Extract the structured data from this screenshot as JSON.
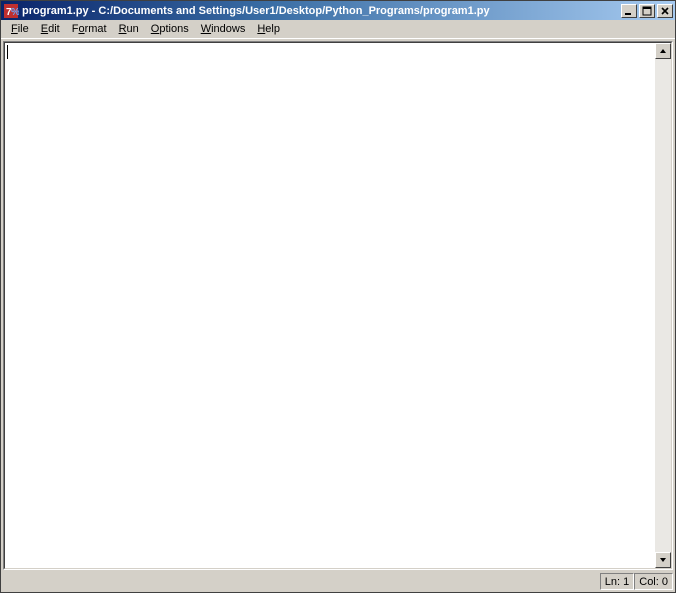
{
  "titlebar": {
    "title": "program1.py - C:/Documents and Settings/User1/Desktop/Python_Programs/program1.py"
  },
  "menu": {
    "file": "File",
    "edit": "Edit",
    "format": "Format",
    "run": "Run",
    "options": "Options",
    "windows": "Windows",
    "help": "Help"
  },
  "editor": {
    "content": ""
  },
  "status": {
    "line": "Ln: 1",
    "col": "Col: 0"
  }
}
